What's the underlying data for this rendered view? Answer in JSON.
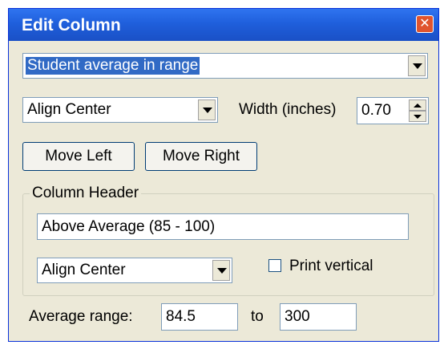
{
  "window": {
    "title": "Edit Column"
  },
  "column_type": {
    "value": "Student average in range"
  },
  "column_alignment": {
    "value": "Align Center"
  },
  "width": {
    "label": "Width (inches)",
    "value": "0.70"
  },
  "buttons": {
    "move_left": "Move Left",
    "move_right": "Move Right"
  },
  "column_header": {
    "legend": "Column Header",
    "text": "Above Average (85 - 100)",
    "alignment": "Align Center",
    "print_vertical_label": "Print vertical",
    "print_vertical_checked": false
  },
  "average_range": {
    "label": "Average range:",
    "from": "84.5",
    "to_label": "to",
    "to": "300"
  }
}
